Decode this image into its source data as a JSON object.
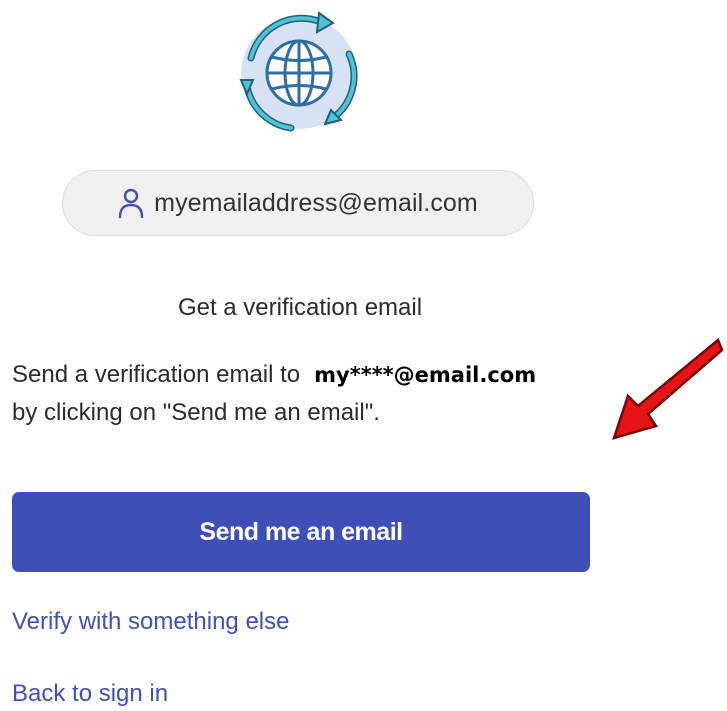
{
  "identifier": {
    "icon": "user-icon",
    "email": "myemailaddress@email.com"
  },
  "page": {
    "heading": "Get a verification email",
    "description_prefix": "Send a verification email to",
    "masked_email": "my****@email.com",
    "description_suffix": "by clicking on \"Send me an email\"."
  },
  "actions": {
    "primary_label": "Send me an email",
    "verify_else_label": "Verify with something else",
    "back_label": "Back to sign in"
  },
  "colors": {
    "primary_button": "#3f4fb8",
    "link": "#4051b5",
    "annotation_arrow": "#e61414",
    "logo_ring": "#2fb3c0",
    "logo_globe": "#2d6ea3"
  }
}
